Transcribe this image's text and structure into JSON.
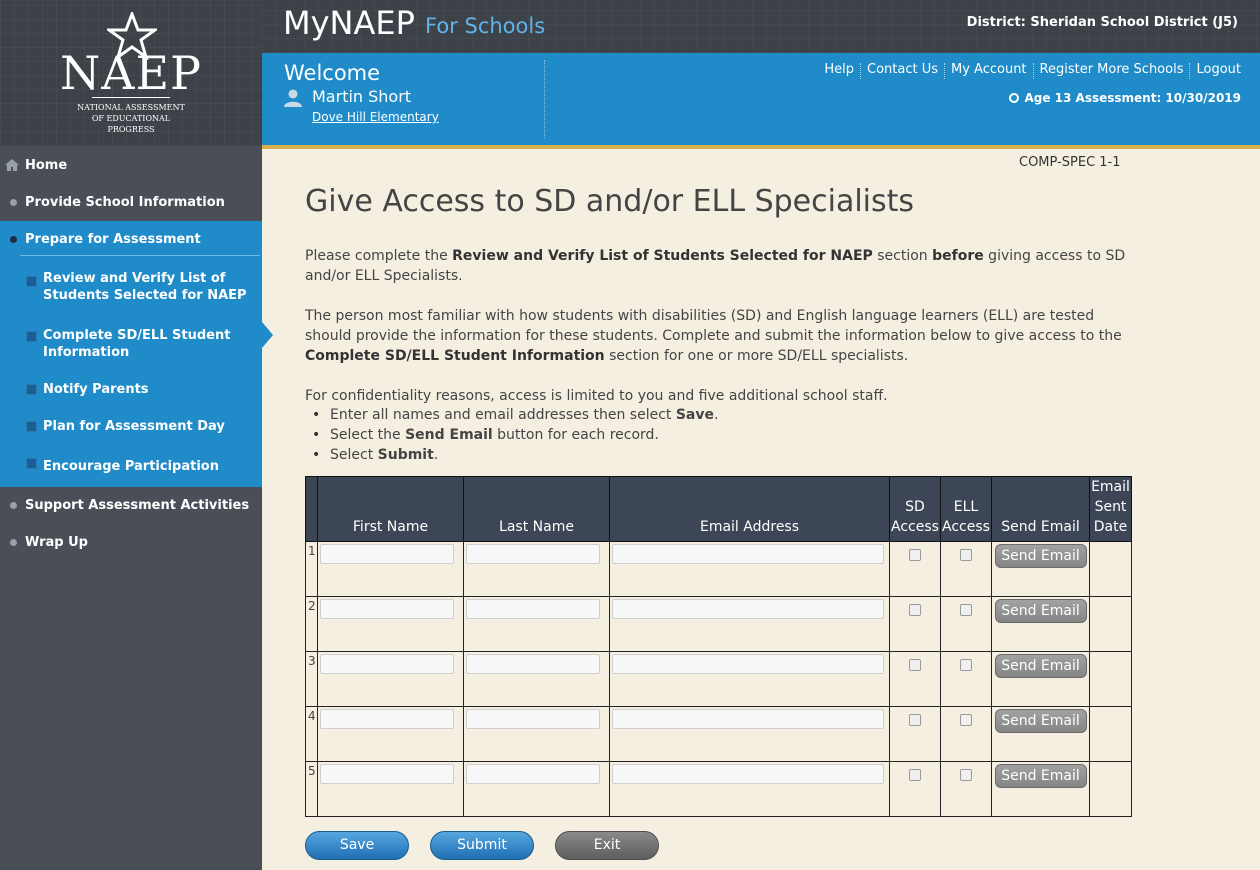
{
  "brand": {
    "logo": "NAEP",
    "logo_sub_lines": [
      "NATIONAL ASSESSMENT",
      "OF EDUCATIONAL",
      "PROGRESS"
    ],
    "main": "MyNAEP",
    "sub": "For Schools"
  },
  "header": {
    "district": "District: Sheridan School District (J5)",
    "welcome": "Welcome",
    "user_name": "Martin Short",
    "school": "Dove Hill Elementary",
    "links": [
      "Help",
      "Contact Us",
      "My Account",
      "Register More Schools",
      "Logout"
    ],
    "assessment": "Age 13 Assessment: 10/30/2019"
  },
  "sidebar": {
    "home": "Home",
    "provide": "Provide School Information",
    "prepare": "Prepare for Assessment",
    "sub_items": [
      "Review and Verify List of Students Selected for NAEP",
      "Complete SD/ELL Student Information",
      "Notify Parents",
      "Plan for Assessment Day",
      "Encourage Participation"
    ],
    "support": "Support Assessment Activities",
    "wrap": "Wrap Up"
  },
  "main": {
    "code": "COMP-SPEC 1-1",
    "title": "Give Access to SD and/or ELL Specialists",
    "p1_a": "Please complete the ",
    "p1_b": "Review and Verify List of Students Selected for NAEP",
    "p1_c": " section ",
    "p1_d": "before",
    "p1_e": " giving access to SD and/or ELL Specialists.",
    "p2_a": "The person most familiar with how students with disabilities (SD) and English language learners (ELL) are tested should provide the information for these students. Complete and submit the information below to give access to the ",
    "p2_b": "Complete SD/ELL Student Information",
    "p2_c": " section for one or more SD/ELL specialists.",
    "p3": "For confidentiality reasons, access is limited to you and five additional school staff.",
    "step1_a": "Enter all names and email addresses then select ",
    "step1_b": "Save",
    "step2_a": "Select the ",
    "step2_b": "Send Email",
    "step2_c": " button for each record.",
    "step3_a": "Select ",
    "step3_b": "Submit",
    "period": "."
  },
  "table": {
    "headers": {
      "first": "First Name",
      "last": "Last Name",
      "email": "Email Address",
      "sd": [
        "SD",
        "Access"
      ],
      "ell": [
        "ELL",
        "Access"
      ],
      "send": "Send Email",
      "sent": [
        "Email",
        "Sent",
        "Date"
      ]
    },
    "rows": [
      "1",
      "2",
      "3",
      "4",
      "5"
    ],
    "send_label": "Send Email"
  },
  "buttons": {
    "save": "Save",
    "submit": "Submit",
    "exit": "Exit"
  },
  "colors": {
    "accent_blue": "#1f8bc9",
    "dark_header": "#3d4249",
    "gold": "#d4ae4b",
    "bg": "#f4efe0"
  }
}
